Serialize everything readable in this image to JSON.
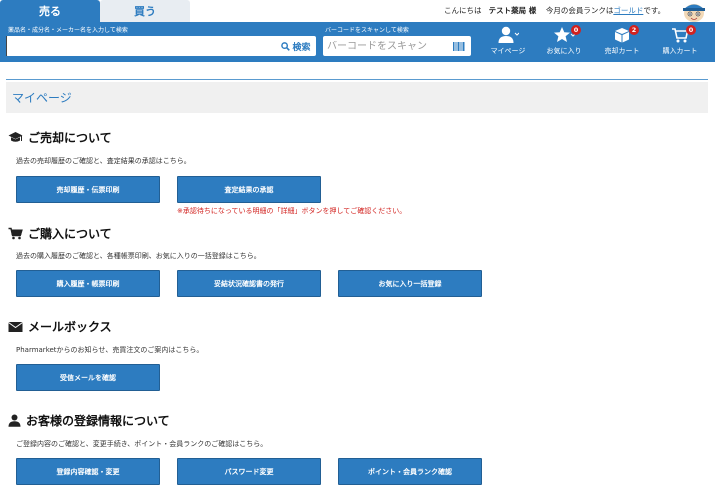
{
  "tabs": {
    "sell": "売る",
    "buy": "買う"
  },
  "greeting": {
    "prefix": "こんにちは",
    "user": "テスト薬局 様",
    "rank_prefix": "今月の会員ランクは",
    "rank": "ゴールド",
    "rank_suffix": "です。"
  },
  "search": {
    "label": "薬品名・成分名・メーカー名を入力して検索",
    "value": "",
    "button_label": "検索"
  },
  "barcode": {
    "label": "バーコードをスキャンして検索",
    "placeholder": "バーコードをスキャン"
  },
  "nav": {
    "mypage": {
      "label": "マイページ"
    },
    "favorites": {
      "label": "お気に入り",
      "count": "0"
    },
    "sell_cart": {
      "label": "売却カート",
      "count": "2"
    },
    "buy_cart": {
      "label": "購入カート",
      "count": "0"
    }
  },
  "page_title": "マイページ",
  "sections": {
    "sell": {
      "title": "ご売却について",
      "desc": "過去の売却履歴のご確認と、査定結果の承認はこちら。",
      "buttons": [
        "売却履歴・伝票印刷",
        "査定結果の承認"
      ],
      "note": "※承認待ちになっている明細の「詳細」ボタンを押してご確認ください。"
    },
    "buy": {
      "title": "ご購入について",
      "desc": "過去の購入履歴のご確認と、各種帳票印刷、お気に入りの一括登録はこちら。",
      "buttons": [
        "購入履歴・帳票印刷",
        "妥結状況確認書の発行",
        "お気に入り一括登録"
      ]
    },
    "mail": {
      "title": "メールボックス",
      "desc": "Pharmarketからのお知らせ、売買注文のご案内はこちら。",
      "buttons": [
        "受信メールを確認"
      ]
    },
    "account": {
      "title": "お客様の登録情報について",
      "desc": "ご登録内容のご確認と、変更手続き、ポイント・会員ランクのご確認はこちら。",
      "buttons": [
        "登録内容確認・変更",
        "パスワード変更",
        "ポイント・会員ランク確認"
      ]
    }
  },
  "colors": {
    "primary": "#2d7cc0",
    "badge": "#d2221f",
    "note": "#d2221f"
  }
}
